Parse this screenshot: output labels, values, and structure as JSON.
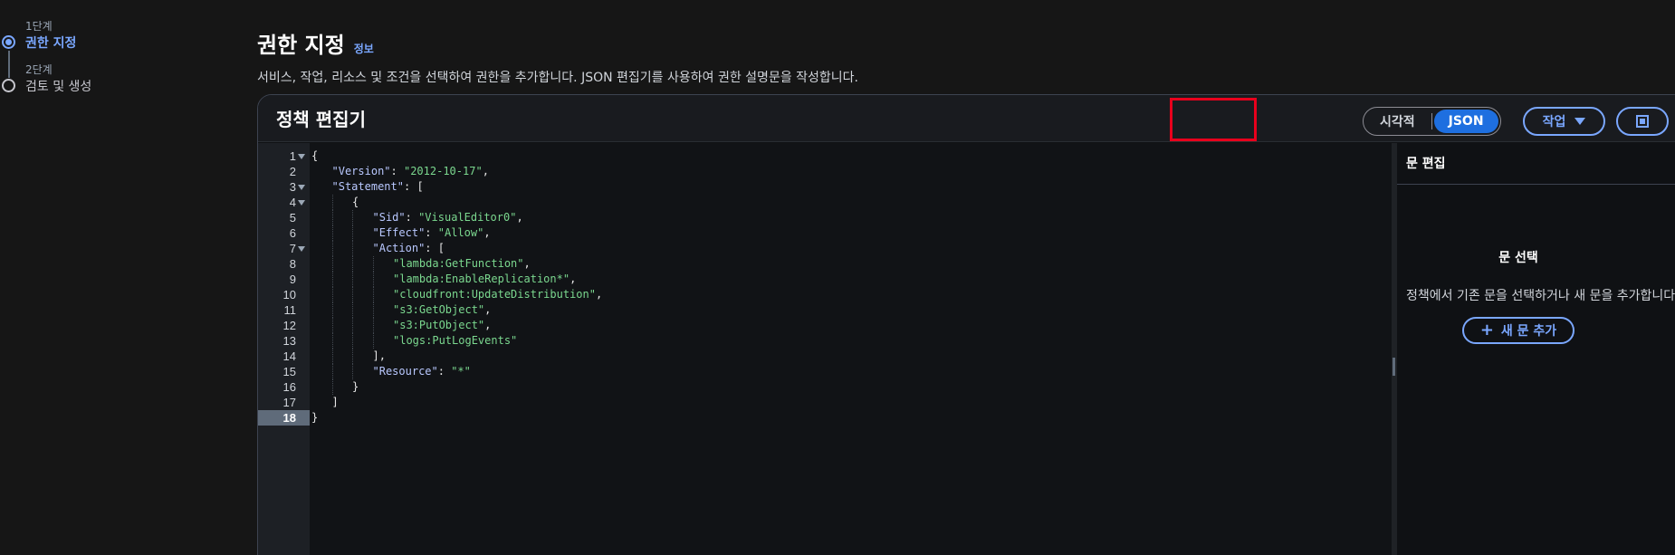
{
  "steps": [
    {
      "sub": "1단계",
      "label": "권한 지정",
      "active": true
    },
    {
      "sub": "2단계",
      "label": "검토 및 생성",
      "active": false
    }
  ],
  "header": {
    "title": "권한 지정",
    "info": "정보",
    "description": "서비스, 작업, 리소스 및 조건을 선택하여 권한을 추가합니다. JSON 편집기를 사용하여 권한 설명문을 작성합니다."
  },
  "editor_panel": {
    "title": "정책 편집기",
    "mode_visual": "시각적",
    "mode_json": "JSON",
    "actions_label": "작업",
    "active_line": 18
  },
  "code_lines": [
    {
      "n": "1",
      "fold": true,
      "indent": 0,
      "text": "{"
    },
    {
      "n": "2",
      "fold": false,
      "indent": 1,
      "key": "\"Version\"",
      "sep": ": ",
      "val": "\"2012-10-17\"",
      "tail": ","
    },
    {
      "n": "3",
      "fold": true,
      "indent": 1,
      "key": "\"Statement\"",
      "sep": ": ",
      "tail": "["
    },
    {
      "n": "4",
      "fold": true,
      "indent": 2,
      "text": "{"
    },
    {
      "n": "5",
      "fold": false,
      "indent": 3,
      "key": "\"Sid\"",
      "sep": ": ",
      "val": "\"VisualEditor0\"",
      "tail": ","
    },
    {
      "n": "6",
      "fold": false,
      "indent": 3,
      "key": "\"Effect\"",
      "sep": ": ",
      "val": "\"Allow\"",
      "tail": ","
    },
    {
      "n": "7",
      "fold": true,
      "indent": 3,
      "key": "\"Action\"",
      "sep": ": ",
      "tail": "["
    },
    {
      "n": "8",
      "fold": false,
      "indent": 4,
      "val": "\"lambda:GetFunction\"",
      "tail": ","
    },
    {
      "n": "9",
      "fold": false,
      "indent": 4,
      "val": "\"lambda:EnableReplication*\"",
      "tail": ","
    },
    {
      "n": "10",
      "fold": false,
      "indent": 4,
      "val": "\"cloudfront:UpdateDistribution\"",
      "tail": ","
    },
    {
      "n": "11",
      "fold": false,
      "indent": 4,
      "val": "\"s3:GetObject\"",
      "tail": ","
    },
    {
      "n": "12",
      "fold": false,
      "indent": 4,
      "val": "\"s3:PutObject\"",
      "tail": ","
    },
    {
      "n": "13",
      "fold": false,
      "indent": 4,
      "val": "\"logs:PutLogEvents\"",
      "tail": ""
    },
    {
      "n": "14",
      "fold": false,
      "indent": 3,
      "text": "],"
    },
    {
      "n": "15",
      "fold": false,
      "indent": 3,
      "key": "\"Resource\"",
      "sep": ": ",
      "val": "\"*\"",
      "tail": ""
    },
    {
      "n": "16",
      "fold": false,
      "indent": 2,
      "text": "}"
    },
    {
      "n": "17",
      "fold": false,
      "indent": 1,
      "text": "]"
    },
    {
      "n": "18",
      "fold": false,
      "indent": 0,
      "text": "}"
    }
  ],
  "side_panel": {
    "title": "문 편집",
    "empty_title": "문 선택",
    "empty_desc": "정책에서 기존 문을 선택하거나 새 문을 추가합니다.",
    "add_label": "새 문 추가"
  },
  "colors": {
    "accent": "#7aa7ff",
    "selected": "#1e6fe0",
    "highlight": "#e8001c"
  }
}
